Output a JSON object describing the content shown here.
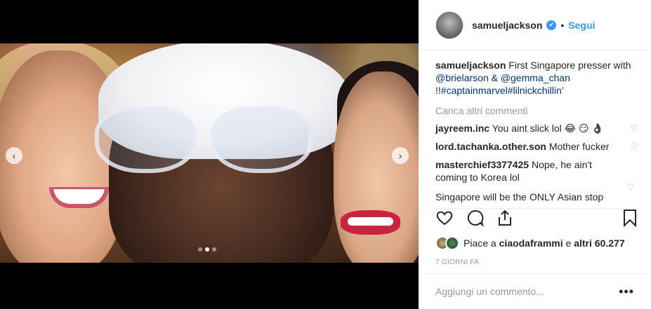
{
  "post": {
    "dots": [
      false,
      true,
      false
    ]
  },
  "header": {
    "username": "samueljackson",
    "separator": "•",
    "follow_label": "Segui"
  },
  "caption": {
    "username": "samueljackson",
    "text_before": "First Singapore presser with",
    "mention1": "@brielarson",
    "amp": "&",
    "mention2": "@gemma_chan",
    "bangs": "!!",
    "tag1": "#captainmarvel",
    "tag2": "#lilnickchillin",
    "trail": "’"
  },
  "load_more_label": "Carica altri commenti",
  "comments": [
    {
      "username": "jayreem.inc",
      "text": "You aint slick lol 😂 😏 👌🏿"
    },
    {
      "username": "lord.tachanka.other.son",
      "text": "Mother fucker"
    },
    {
      "username": "masterchief3377425",
      "text": "Nope, he ain't coming to Korea lol"
    },
    {
      "username": "",
      "text": "Singapore will be the ONLY Asian stop"
    }
  ],
  "likes": {
    "prefix": "Piace a",
    "user": "ciaodaframmi",
    "conj": "e",
    "others": "altri 60.277"
  },
  "timestamp": "7 GIORNI FA",
  "add_comment": {
    "placeholder": "Aggiungi un commento...",
    "more": "•••"
  },
  "icons": {
    "verified": "✔",
    "heart": "♡",
    "prev": "‹",
    "next": "›"
  },
  "colors": {
    "link": "#003569",
    "accent": "#3897f0",
    "muted": "#999999"
  }
}
